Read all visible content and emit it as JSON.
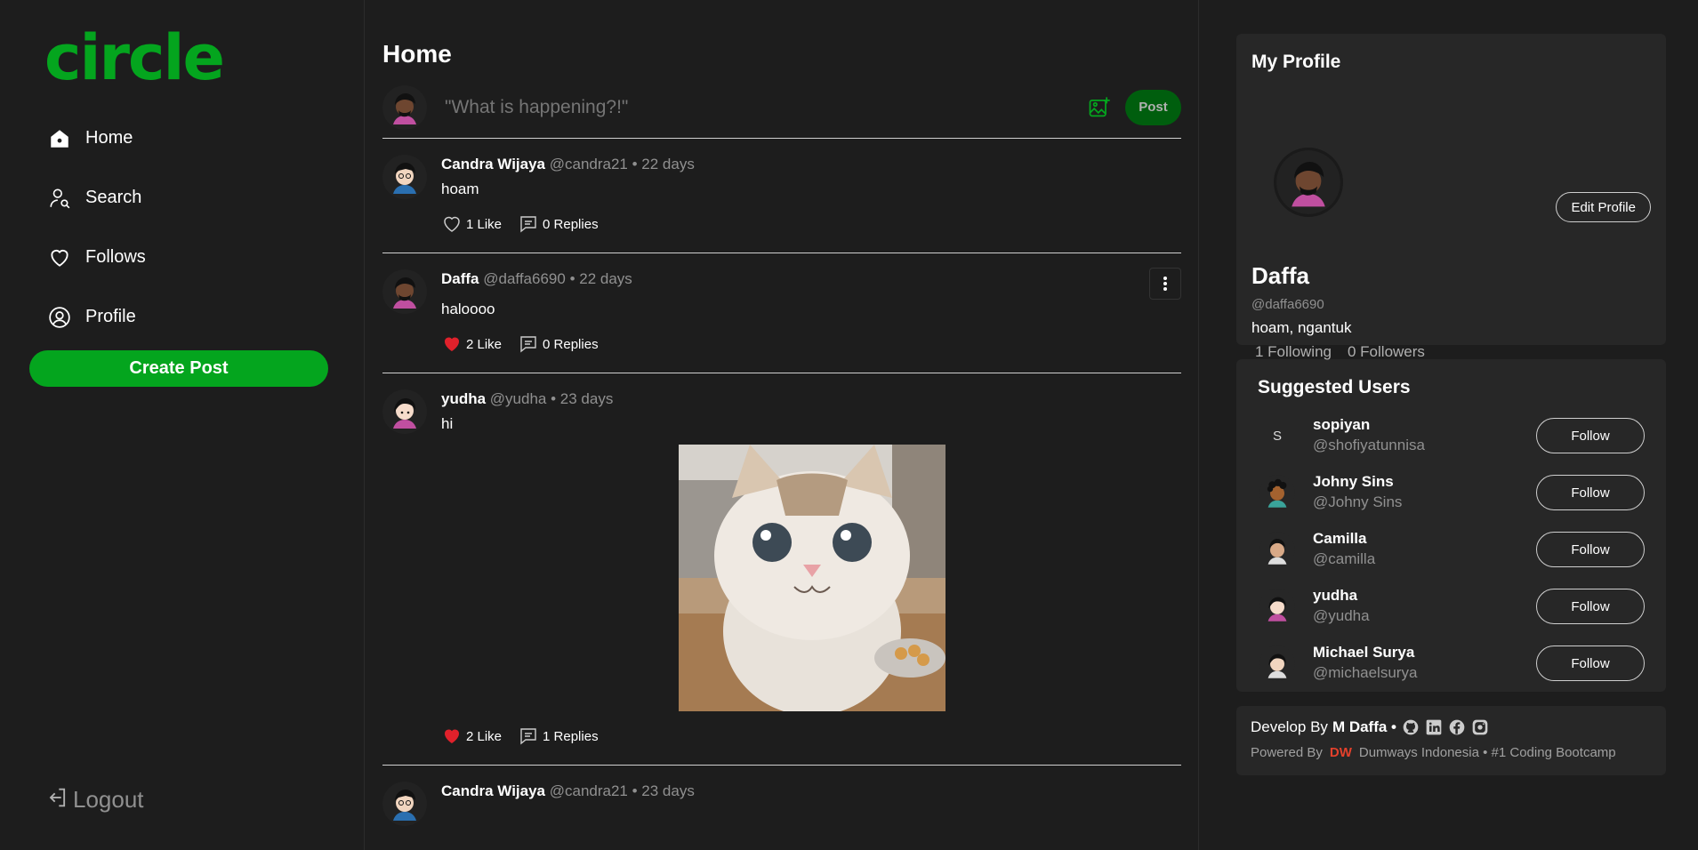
{
  "app": {
    "logo": "circle"
  },
  "nav": {
    "items": [
      {
        "label": "Home",
        "icon": "home-icon"
      },
      {
        "label": "Search",
        "icon": "search-user-icon"
      },
      {
        "label": "Follows",
        "icon": "heart-icon"
      },
      {
        "label": "Profile",
        "icon": "profile-icon"
      }
    ],
    "create_post": "Create Post",
    "logout": "Logout"
  },
  "main": {
    "title": "Home",
    "composer": {
      "placeholder": "\"What is happening?!\"",
      "post_label": "Post"
    },
    "posts": [
      {
        "name": "Candra Wijaya",
        "handle": "@candra21",
        "time": "• 22 days",
        "text": "hoam",
        "likes": "1 Like",
        "liked": false,
        "replies": "0 Replies"
      },
      {
        "name": "Daffa",
        "handle": "@daffa6690",
        "time": "• 22 days",
        "text": "haloooo",
        "likes": "2 Like",
        "liked": true,
        "replies": "0 Replies"
      },
      {
        "name": "yudha",
        "handle": "@yudha",
        "time": "• 23 days",
        "text": "hi",
        "likes": "2 Like",
        "liked": true,
        "replies": "1 Replies"
      },
      {
        "name": "Candra Wijaya",
        "handle": "@candra21",
        "time": "• 23 days"
      }
    ]
  },
  "profile": {
    "title": "My Profile",
    "edit_label": "Edit Profile",
    "name": "Daffa",
    "handle": "@daffa6690",
    "bio": "hoam, ngantuk",
    "following": "1 Following",
    "followers": "0 Followers"
  },
  "suggested": {
    "title": "Suggested Users",
    "follow_label": "Follow",
    "users": [
      {
        "name": "sopiyan",
        "handle": "@shofiyatunnisa",
        "initial": "S"
      },
      {
        "name": "Johny Sins",
        "handle": "@Johny Sins"
      },
      {
        "name": "Camilla",
        "handle": "@camilla"
      },
      {
        "name": "yudha",
        "handle": "@yudha"
      },
      {
        "name": "Michael Surya",
        "handle": "@michaelsurya"
      }
    ]
  },
  "footer": {
    "develop_by": "Develop By",
    "author": "M Daffa •",
    "powered_by": "Powered By",
    "brand_mark": "DW",
    "company": "Dumways Indonesia • #1 Coding Bootcamp"
  },
  "colors": {
    "accent": "#04a51e",
    "post_button": "#005e0e",
    "like": "#e0212b",
    "background": "#1d1d1d",
    "card": "#272727"
  }
}
